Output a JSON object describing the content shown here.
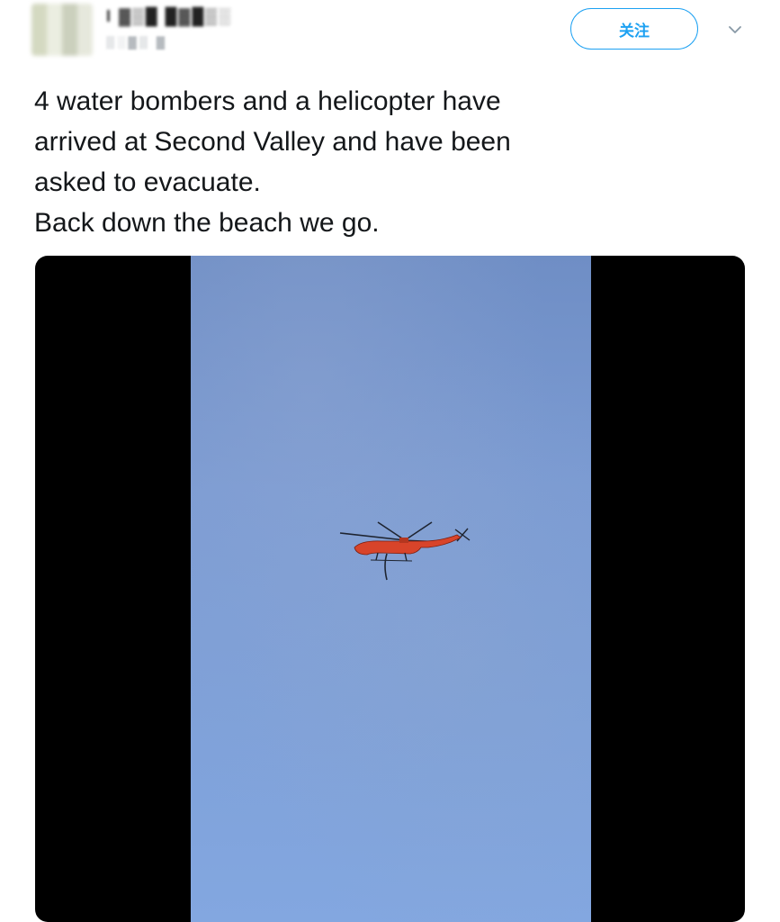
{
  "author": {
    "display_name": "I ▓▒█ █▓█▒░",
    "handle": "▒░▓▒ ▓"
  },
  "follow_button": {
    "label": "关注"
  },
  "tweet": {
    "text": "4 water bombers and a helicopter have\narrived at Second Valley and have been\nasked to evacuate.\nBack down the beach we go."
  },
  "colors": {
    "accent": "#1da1f2",
    "text": "#14171a",
    "media_background": "#000000",
    "sky": "#7b9bd3",
    "helicopter": "#d8442a"
  },
  "icons": {
    "caret": "chevron-down-icon"
  }
}
